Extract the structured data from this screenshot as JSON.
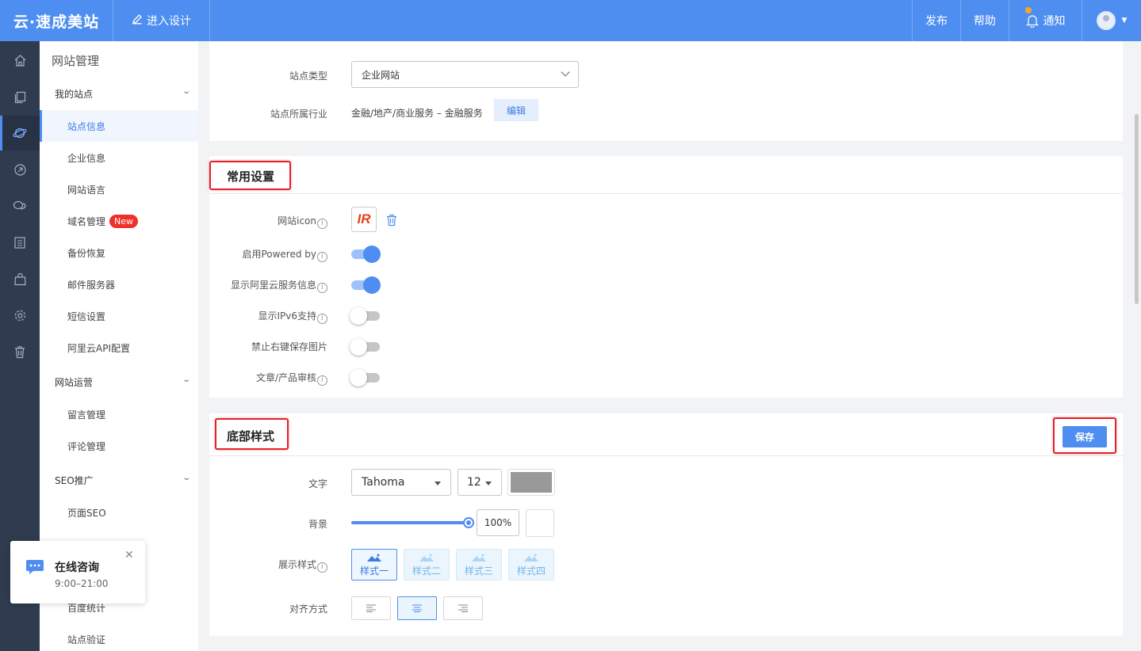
{
  "topbar": {
    "logo": "云·速成美站",
    "design": "进入设计",
    "publish": "发布",
    "help": "帮助",
    "notify": "通知"
  },
  "sidebar": {
    "title": "网站管理",
    "groups": [
      {
        "label": "我的站点",
        "items": [
          "站点信息",
          "企业信息",
          "网站语言",
          "域名管理",
          "备份恢复",
          "邮件服务器",
          "短信设置",
          "阿里云API配置"
        ]
      },
      {
        "label": "网站运营",
        "items": [
          "留言管理",
          "评论管理"
        ]
      },
      {
        "label": "SEO推广",
        "items": [
          "页面SEO",
          "百度统计",
          "站点验证"
        ]
      }
    ],
    "new_badge": "New",
    "active_item": "站点信息"
  },
  "site": {
    "type_label": "站点类型",
    "type_value": "企业网站",
    "industry_label": "站点所属行业",
    "industry_value": "金融/地产/商业服务 – 金融服务",
    "edit_label": "编辑"
  },
  "common": {
    "title": "常用设置",
    "icon_label": "网站icon",
    "icon_text": "IR",
    "settings": [
      {
        "label": "启用Powered by",
        "info": true,
        "on": true
      },
      {
        "label": "显示阿里云服务信息",
        "info": true,
        "on": true
      },
      {
        "label": "显示IPv6支持",
        "info": true,
        "on": false
      },
      {
        "label": "禁止右键保存图片",
        "info": false,
        "on": false
      },
      {
        "label": "文章/产品审核",
        "info": true,
        "on": false
      }
    ]
  },
  "footer_style": {
    "title": "底部样式",
    "save_label": "保存",
    "text_label": "文字",
    "font": "Tahoma",
    "size": "12",
    "text_color": "#999999",
    "bg_label": "背景",
    "bg_opacity": "100%",
    "display_label": "展示样式",
    "styles": [
      "样式一",
      "样式二",
      "样式三",
      "样式四"
    ],
    "selected_style": "样式一",
    "align_label": "对齐方式",
    "align_options": [
      "left",
      "center",
      "right"
    ],
    "selected_align": "center"
  },
  "chat": {
    "title": "在线咨询",
    "hours": "9:00–21:00"
  },
  "colors": {
    "primary": "#4e8ef0",
    "rail": "#2f3b4f",
    "highlight": "#e4202a",
    "new_badge": "#f0302a"
  }
}
